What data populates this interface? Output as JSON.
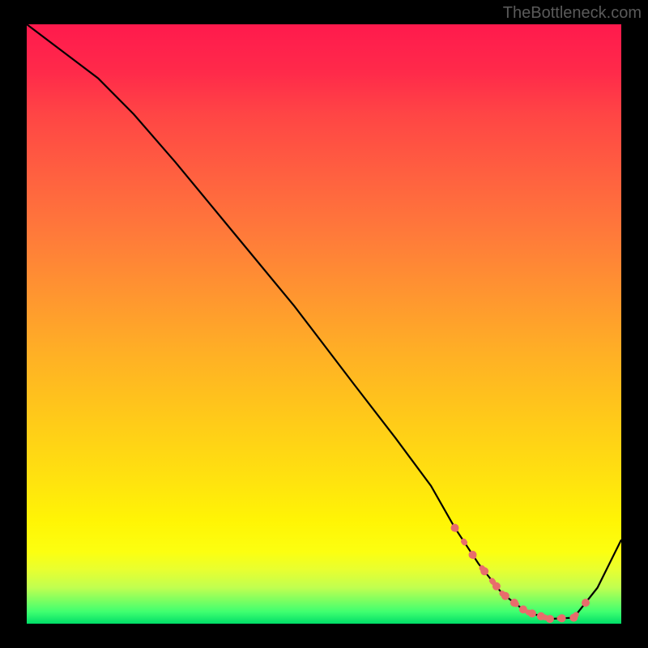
{
  "watermark": "TheBottleneck.com",
  "chart_data": {
    "type": "line",
    "title": "",
    "xlabel": "",
    "ylabel": "",
    "xlim": [
      0,
      100
    ],
    "ylim": [
      0,
      100
    ],
    "series": [
      {
        "name": "curve",
        "x": [
          0,
          4,
          8,
          12,
          18,
          25,
          35,
          45,
          55,
          62,
          68,
          72,
          76,
          80,
          84,
          88,
          92,
          96,
          100
        ],
        "y": [
          100,
          97,
          94,
          91,
          85,
          77,
          65,
          53,
          40,
          31,
          23,
          16,
          10,
          5,
          2,
          0.8,
          1,
          6,
          14
        ]
      }
    ],
    "dot_segment": {
      "start_pct": 72,
      "end_pct": 94,
      "color": "#e86c6c"
    },
    "gradient": {
      "top": "#ff1a4d",
      "bottom": "#00de68"
    }
  }
}
